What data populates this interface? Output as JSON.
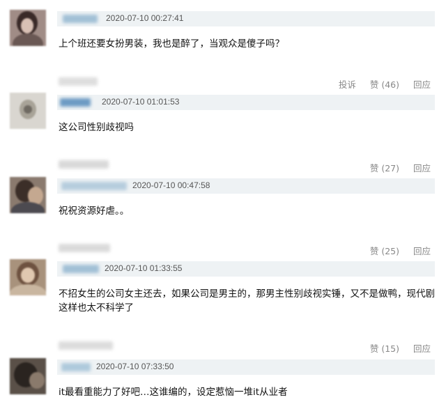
{
  "comments": [
    {
      "time": "2020-07-10 00:27:41",
      "text": "上个班还要女扮男装，我也是醉了，当观众是傻子吗？",
      "actions": {
        "report": "投诉",
        "like": "赞 (46)",
        "reply": "回应"
      }
    },
    {
      "time": "2020-07-10 01:01:53",
      "text": "这公司性别歧视吗",
      "actions": {
        "like": "赞 (27)",
        "reply": "回应"
      }
    },
    {
      "time": "2020-07-10 00:47:58",
      "text": "祝祝资源好虐。。",
      "actions": {
        "like": "赞 (25)",
        "reply": "回应"
      }
    },
    {
      "time": "2020-07-10 01:33:55",
      "text": "不招女生的公司女主还去，如果公司是男主的，那男主性别歧视实锤，又不是做鸭，现代剧这样也太不科学了",
      "actions": {
        "like": "赞 (15)",
        "reply": "回应"
      }
    },
    {
      "time": "2020-07-10 07:33:50",
      "text": "it最看重能力了好吧…这谁编的，设定惹恼一堆it从业者"
    }
  ]
}
